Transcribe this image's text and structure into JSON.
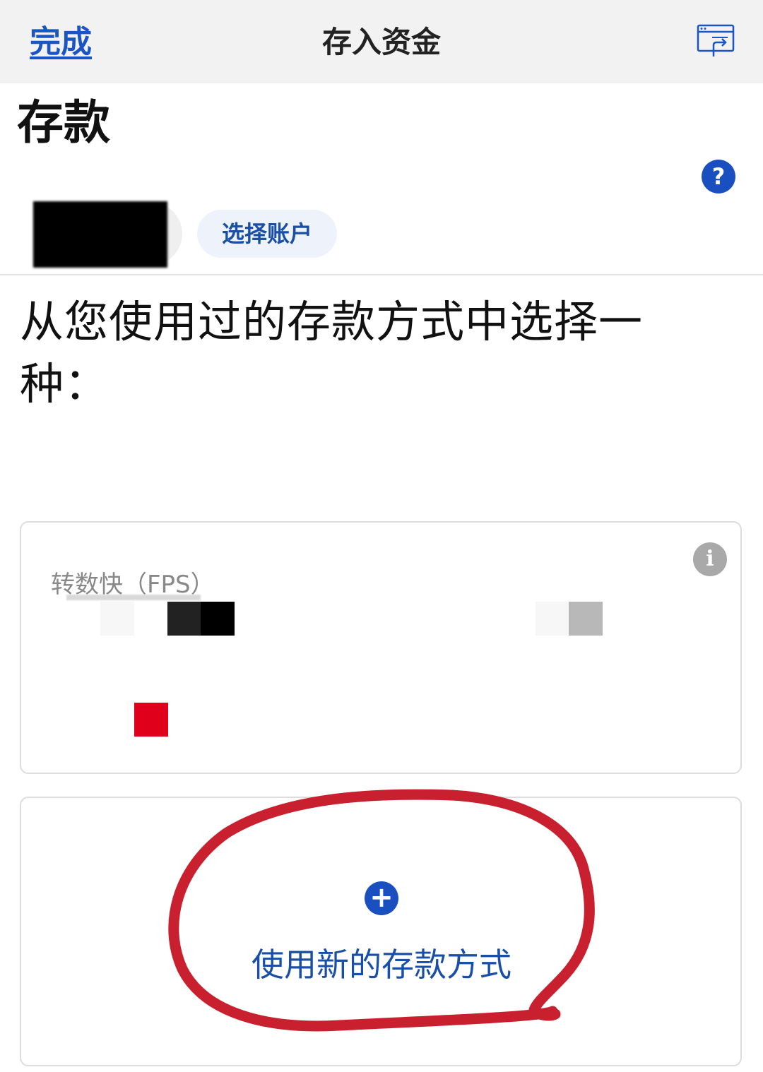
{
  "navbar": {
    "done_label": "完成",
    "title": "存入资金",
    "screen_icon": "screen-share-icon"
  },
  "page": {
    "heading": "存款",
    "help_icon_glyph": "?"
  },
  "account": {
    "select_label": "选择账户"
  },
  "instruction": "从您使用过的存款方式中选择一种：",
  "methods": {
    "fps_label": "转数快（FPS）",
    "info_icon_glyph": "i",
    "new_method_label": "使用新的存款方式",
    "plus_icon_glyph": "+"
  },
  "colors": {
    "accent": "#1a4fc0",
    "annotation": "#c8202f",
    "mosaic_red": "#e0001b"
  }
}
